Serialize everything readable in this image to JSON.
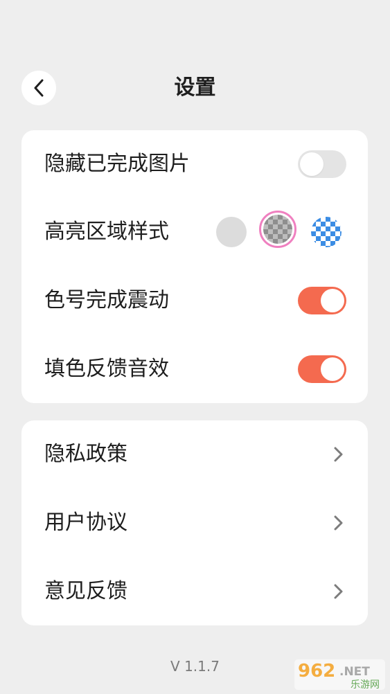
{
  "header": {
    "title": "设置"
  },
  "settings": {
    "hide_completed": {
      "label": "隐藏已完成图片",
      "on": false
    },
    "highlight_style": {
      "label": "高亮区域样式",
      "options": [
        "gray-solid",
        "gray-checker",
        "blue-checker"
      ],
      "selected": "gray-checker"
    },
    "color_vibration": {
      "label": "色号完成震动",
      "on": true
    },
    "fill_sound": {
      "label": "填色反馈音效",
      "on": true
    }
  },
  "links": [
    {
      "label": "隐私政策"
    },
    {
      "label": "用户协议"
    },
    {
      "label": "意见反馈"
    }
  ],
  "version": "V 1.1.7",
  "watermark": {
    "top": "962",
    "net": ".NET",
    "bottom": "乐游网"
  },
  "colors": {
    "accent": "#f46a4f",
    "selected_ring": "#ef80c0",
    "background": "#eeeeee"
  }
}
